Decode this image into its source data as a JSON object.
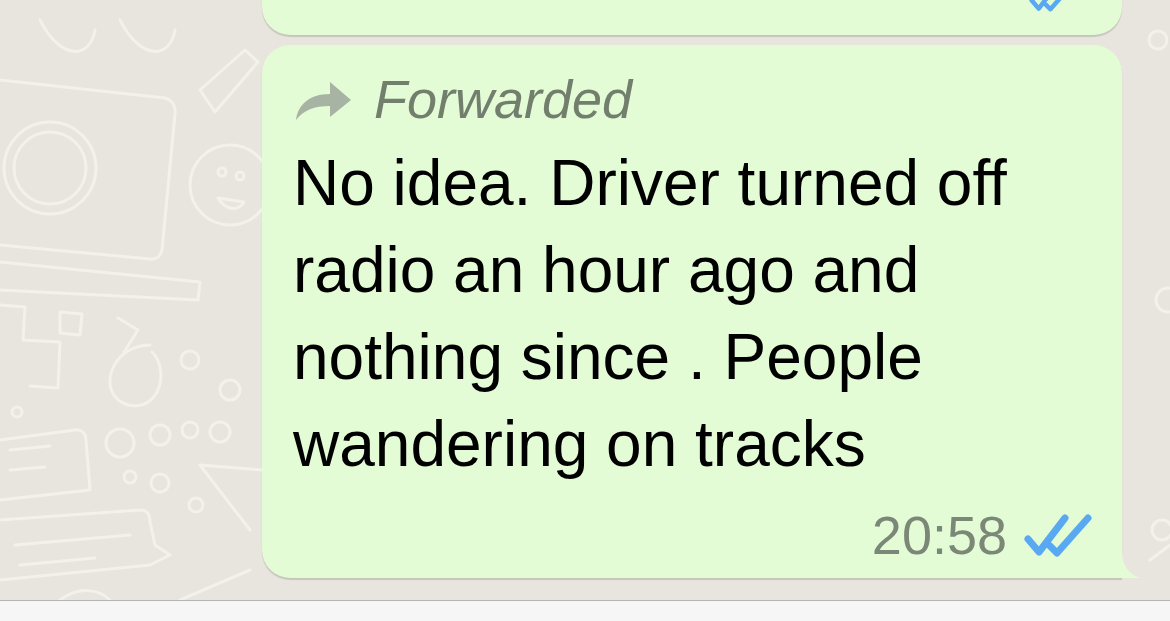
{
  "messages": [
    {
      "kind": "cut_off",
      "read": true
    },
    {
      "kind": "full",
      "forwarded": true,
      "forwarded_label": "Forwarded",
      "text": "No idea. Driver turned off radio an hour ago and nothing since . People wandering on tracks",
      "time": "20:58",
      "read": true
    }
  ]
}
